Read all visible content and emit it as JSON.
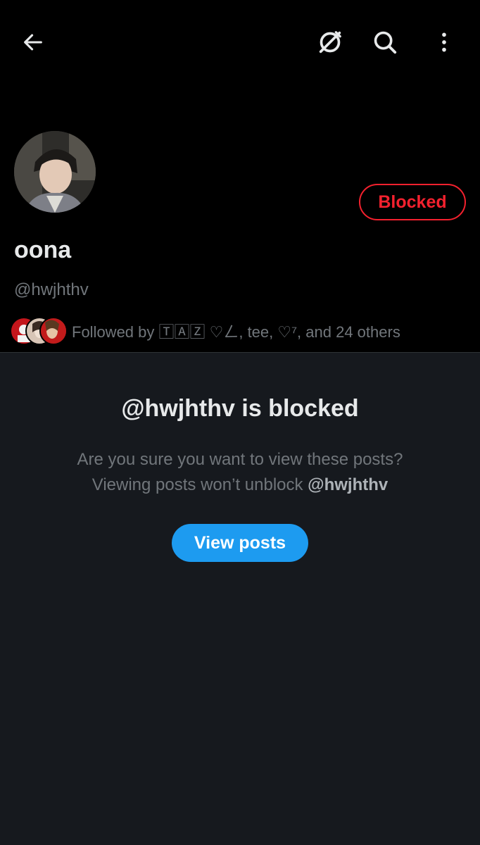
{
  "header": {
    "back_icon": "arrow-left-icon",
    "grok_icon": "grok-icon",
    "search_icon": "search-icon",
    "more_icon": "more-vertical-icon"
  },
  "profile": {
    "display_name": "oona",
    "handle": "@hwjhthv",
    "blocked_label": "Blocked",
    "followed_by": "Followed by 🅃🄰🅉 ♡ㄥ, tee, ♡⁷, and 24 others"
  },
  "blocked_notice": {
    "title": "@hwjhthv is blocked",
    "line1": "Are you sure you want to view these posts?",
    "line2_prefix": "Viewing posts won’t unblock ",
    "line2_handle": "@hwjhthv",
    "button_label": "View posts"
  },
  "colors": {
    "background": "#16191e",
    "header_bg": "#000000",
    "blocked_red": "#f4212e",
    "accent_blue": "#1d9bf0",
    "secondary_text": "#71767b"
  }
}
